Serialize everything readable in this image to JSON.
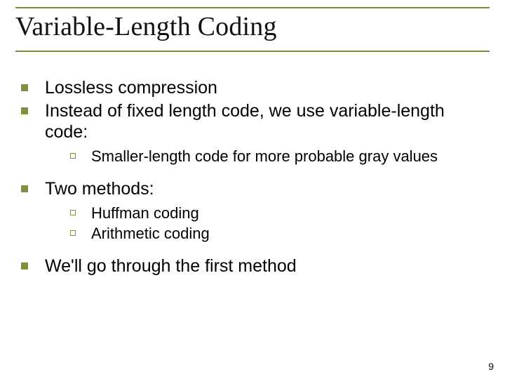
{
  "title": "Variable-Length Coding",
  "bullets": {
    "b1": "Lossless compression",
    "b2": "Instead of fixed length code, we use variable-length code:",
    "b2_sub1": "Smaller-length code for more probable gray values",
    "b3": "Two methods:",
    "b3_sub1": "Huffman coding",
    "b3_sub2": "Arithmetic coding",
    "b4": "We'll go through the first method"
  },
  "page_number": "9"
}
